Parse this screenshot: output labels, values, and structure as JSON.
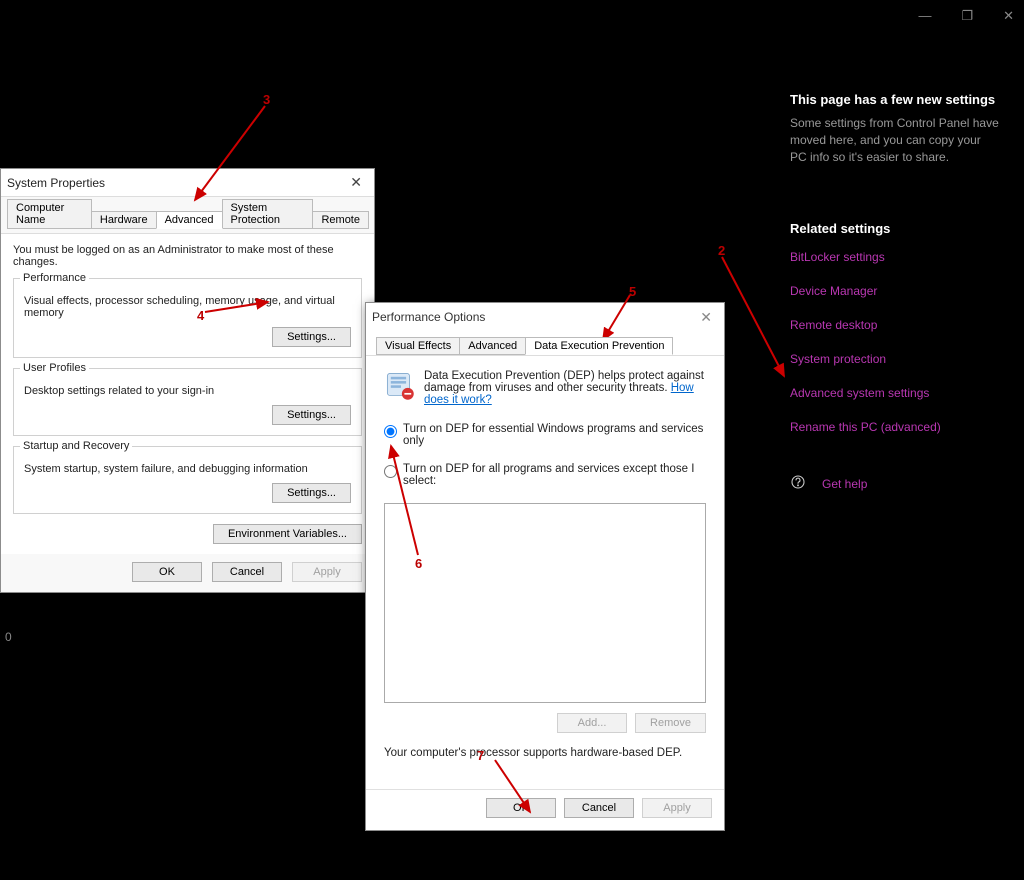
{
  "caption": {
    "minimize": "—",
    "maximize": "❐",
    "close": "✕"
  },
  "right_panel": {
    "heading": "This page has a few new settings",
    "desc": "Some settings from Control Panel have moved here, and you can copy your PC info so it's easier to share.",
    "section": "Related settings",
    "links": [
      "BitLocker settings",
      "Device Manager",
      "Remote desktop",
      "System protection",
      "Advanced system settings",
      "Rename this PC (advanced)"
    ],
    "help_label": "Get help"
  },
  "sys": {
    "title": "System Properties",
    "tabs": [
      "Computer Name",
      "Hardware",
      "Advanced",
      "System Protection",
      "Remote"
    ],
    "active_tab": 2,
    "adm_note": "You must be logged on as an Administrator to make most of these changes.",
    "groups": {
      "performance": {
        "legend": "Performance",
        "desc": "Visual effects, processor scheduling, memory usage, and virtual memory",
        "btn": "Settings..."
      },
      "user_profiles": {
        "legend": "User Profiles",
        "desc": "Desktop settings related to your sign-in",
        "btn": "Settings..."
      },
      "startup": {
        "legend": "Startup and Recovery",
        "desc": "System startup, system failure, and debugging information",
        "btn": "Settings..."
      }
    },
    "env_btn": "Environment Variables...",
    "ok": "OK",
    "cancel": "Cancel",
    "apply": "Apply"
  },
  "perf": {
    "title": "Performance Options",
    "tabs": [
      "Visual Effects",
      "Advanced",
      "Data Execution Prevention"
    ],
    "active_tab": 2,
    "dep_intro": "Data Execution Prevention (DEP) helps protect against damage from viruses and other security threats. ",
    "dep_link": "How does it work?",
    "radio1": "Turn on DEP for essential Windows programs and services only",
    "radio2": "Turn on DEP for all programs and services except those I select:",
    "add": "Add...",
    "remove": "Remove",
    "support": "Your computer's processor supports hardware-based DEP.",
    "ok": "OK",
    "cancel": "Cancel",
    "apply": "Apply"
  },
  "annotations": {
    "n2": "2",
    "n3": "3",
    "n4": "4",
    "n5": "5",
    "n6": "6",
    "n7": "7"
  },
  "stray_zero": "0"
}
